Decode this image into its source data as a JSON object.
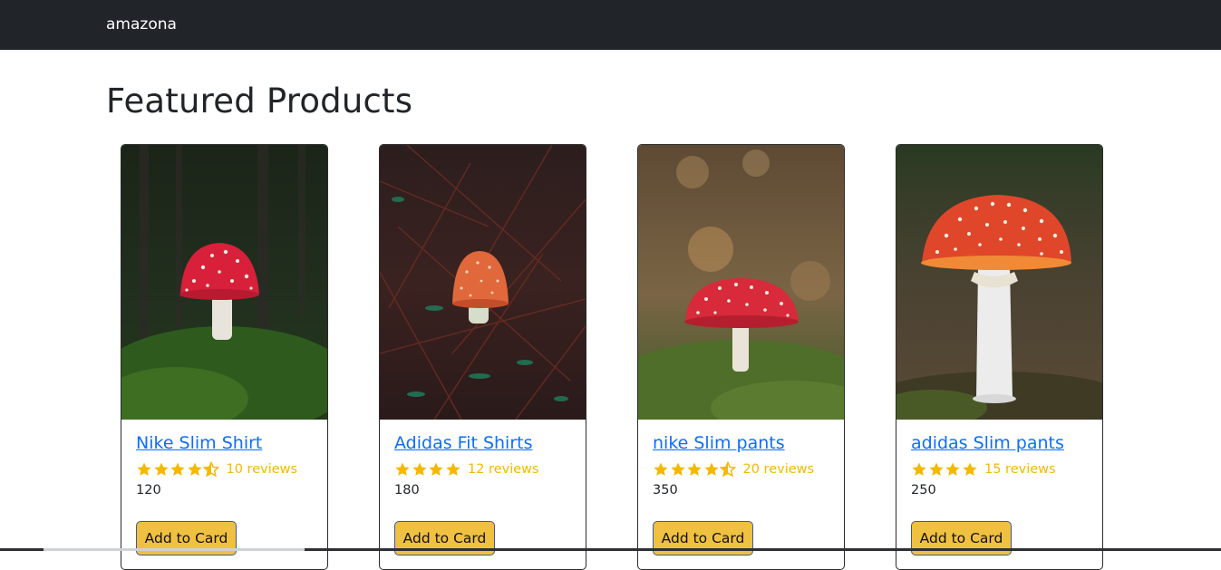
{
  "navbar": {
    "brand": "amazona"
  },
  "page": {
    "title": "Featured Products"
  },
  "colors": {
    "navbar_bg": "#212529",
    "link": "#0d6efd",
    "star": "#f5b800",
    "button_bg": "#f0c040"
  },
  "products": [
    {
      "name": "Nike Slim Shirt",
      "rating": 4.5,
      "reviews_text": "10 reviews",
      "price": "120",
      "button_label": "Add to Card",
      "image_icon": "mushroom-image"
    },
    {
      "name": "Adidas Fit Shirts",
      "rating": 4,
      "reviews_text": "12 reviews",
      "price": "180",
      "button_label": "Add to Card",
      "image_icon": "mushroom-image"
    },
    {
      "name": "nike Slim pants",
      "rating": 4.5,
      "reviews_text": "20 reviews",
      "price": "350",
      "button_label": "Add to Card",
      "image_icon": "mushroom-image"
    },
    {
      "name": "adidas Slim pants",
      "rating": 4,
      "reviews_text": "15 reviews",
      "price": "250",
      "button_label": "Add to Card",
      "image_icon": "mushroom-image"
    }
  ]
}
